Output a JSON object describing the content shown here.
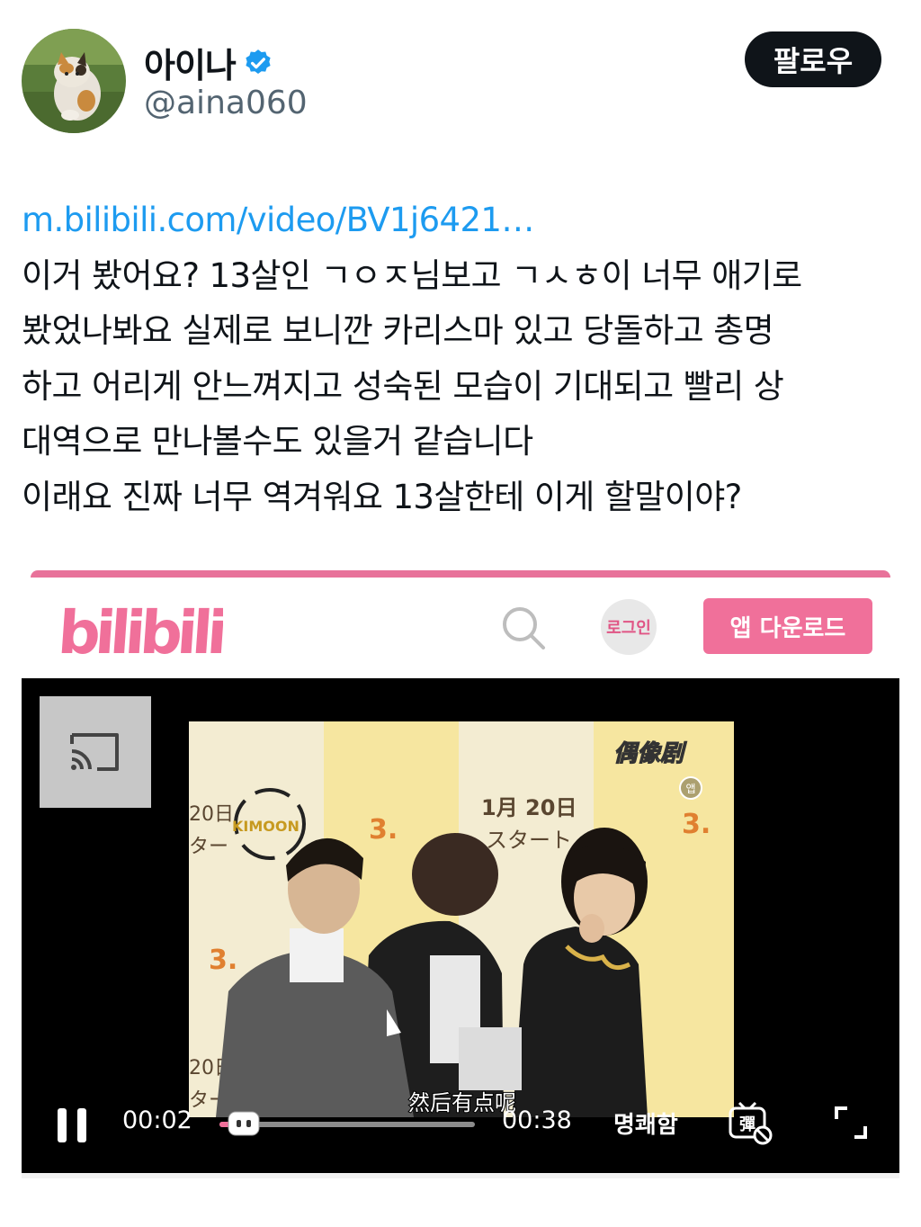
{
  "user": {
    "display_name": "아이나",
    "handle": "@aina060",
    "verified": true,
    "follow_label": "팔로우"
  },
  "tweet": {
    "link": "m.bilibili.com/video/BV1j6421…",
    "lines": [
      "이거 봤어요? 13살인 ㄱㅇㅈ님보고 ㄱㅅㅎ이 너무 애기로",
      "봤었나봐요 실제로 보니깐 카리스마 있고 당돌하고 총명",
      "하고 어리게 안느껴지고 성숙된 모습이 기대되고 빨리 상",
      "대역으로 만나볼수도 있을거 같습니다",
      "이래요 진짜 너무 역겨워요 13살한테 이게 할말이야?"
    ]
  },
  "card": {
    "logo_text": "bilibili",
    "login_label": "로그인",
    "download_label": "앱 다운로드",
    "player": {
      "current_time": "00:02",
      "total_time": "00:38",
      "quality_label": "명쾌함",
      "subtitle": "然后有点呢",
      "app_badge": "앱",
      "progress_fraction": 0.05
    },
    "video_overlay": {
      "date_text": "1月 20日",
      "jp_text": "スタート",
      "left_date": "20日",
      "left_jp": "ター",
      "logo_text": "KIMOON",
      "corner_logo": "偶像剧",
      "brand_mark": "3."
    }
  },
  "colors": {
    "link": "#1d9bf0",
    "bilibili_pink": "#f0709a",
    "verified": "#1d9bf0",
    "follow_bg": "#0f1419"
  },
  "icons": [
    "verified-badge-icon",
    "search-icon",
    "cast-icon",
    "pause-icon",
    "danmaku-icon",
    "fullscreen-icon"
  ]
}
